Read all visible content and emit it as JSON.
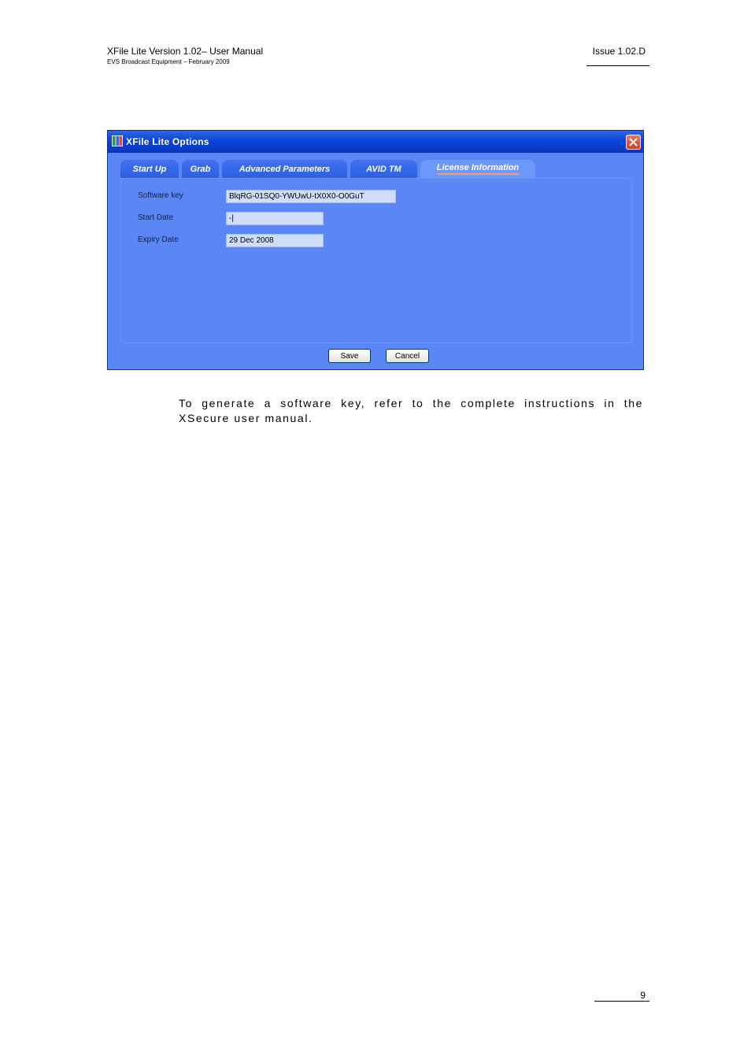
{
  "header": {
    "title": "XFile Lite Version 1.02– User Manual",
    "subtitle": "EVS Broadcast Equipment – February 2009",
    "issue": "Issue 1.02.D"
  },
  "dialog": {
    "title": "XFile Lite Options",
    "tabs": [
      {
        "label": "Start Up"
      },
      {
        "label": "Grab"
      },
      {
        "label": "Advanced Parameters"
      },
      {
        "label": "AVID TM"
      },
      {
        "label": "License Information",
        "active": true
      }
    ],
    "fields": {
      "software_key": {
        "label": "Software key",
        "value": "BlqRG-01SQ0-YWUwU-tX0X0-O0GuT"
      },
      "start_date": {
        "label": "Start Date",
        "value": "-|"
      },
      "expiry_date": {
        "label": "Expiry Date",
        "value": "29 Dec 2008"
      }
    },
    "buttons": {
      "save": "Save",
      "cancel": "Cancel"
    }
  },
  "body": {
    "paragraph": "To generate a software key, refer to the complete instructions in the XSecure user manual."
  },
  "footer": {
    "page_number": "9"
  }
}
